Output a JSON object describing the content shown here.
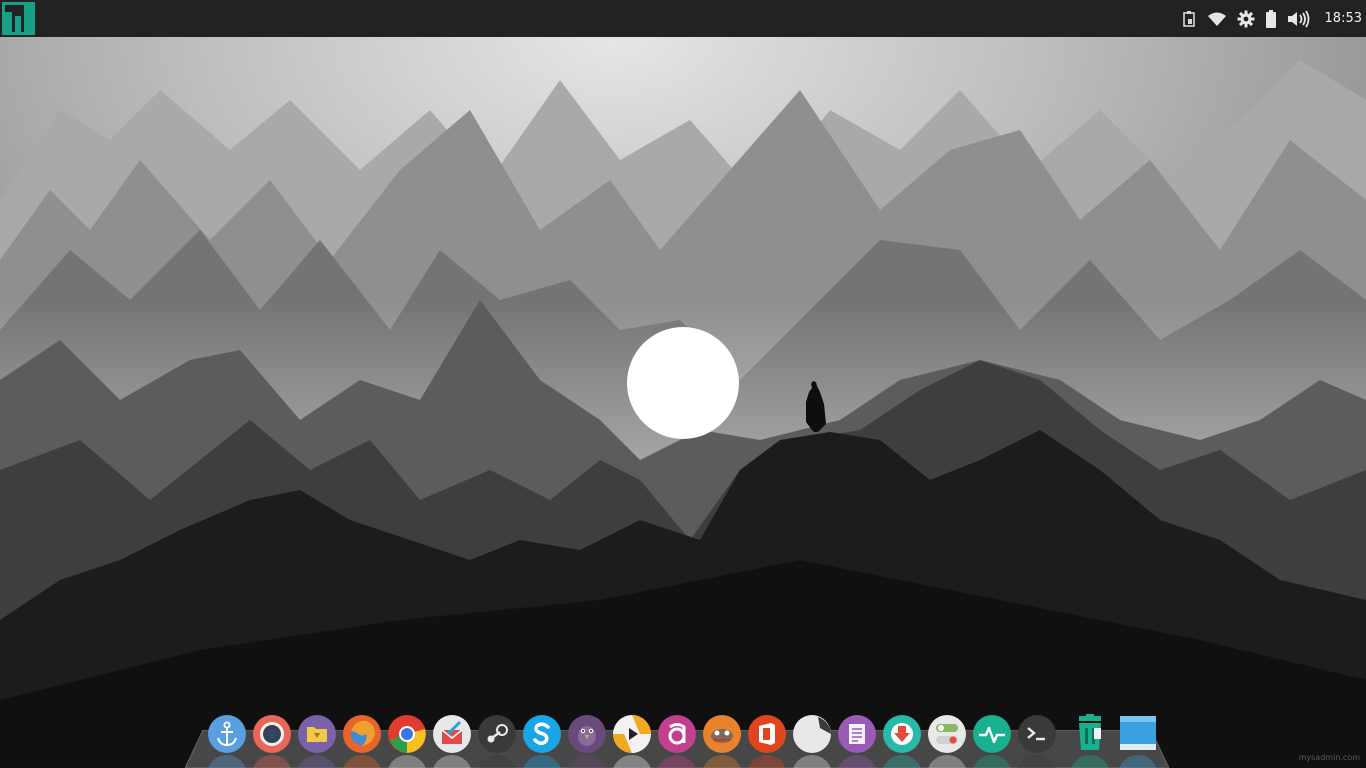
{
  "panel": {
    "clock": "18:53",
    "tray_icons": [
      "clipboard-icon",
      "wifi-icon",
      "settings-gear-icon",
      "battery-icon",
      "volume-icon"
    ],
    "menu_icon": "manjaro-logo-icon",
    "colors": {
      "background": "#222222",
      "accent": "#16a085"
    }
  },
  "dock": {
    "items": [
      {
        "name": "anchor-app-icon",
        "color": "#5aa0e0"
      },
      {
        "name": "screenshot-app-icon",
        "color": "#e8665a"
      },
      {
        "name": "file-manager-icon",
        "color": "#7a62a8"
      },
      {
        "name": "firefox-icon",
        "color": "#e8642c"
      },
      {
        "name": "chrome-icon",
        "color": "#e8e8e8"
      },
      {
        "name": "mail-app-icon",
        "color": "#e8e8e8"
      },
      {
        "name": "steam-icon",
        "color": "#3a3a3a"
      },
      {
        "name": "skype-icon",
        "color": "#1aa6e6"
      },
      {
        "name": "pidgin-icon",
        "color": "#6a4a7a"
      },
      {
        "name": "media-player-icon",
        "color": "#f2f2f2"
      },
      {
        "name": "app-store-icon",
        "color": "#c24090"
      },
      {
        "name": "gimp-icon",
        "color": "#e8822c"
      },
      {
        "name": "office-icon",
        "color": "#e0451e"
      },
      {
        "name": "notes-app-icon",
        "color": "#e8e8e8"
      },
      {
        "name": "text-editor-icon",
        "color": "#9a5ab8"
      },
      {
        "name": "software-update-icon",
        "color": "#2ab8a8"
      },
      {
        "name": "settings-toggle-icon",
        "color": "#e8e8e8"
      },
      {
        "name": "system-monitor-icon",
        "color": "#18b090"
      },
      {
        "name": "terminal-icon",
        "color": "#3a3a3a"
      },
      {
        "name": "trash-icon",
        "color": "#1aaf8f"
      },
      {
        "name": "show-desktop-icon",
        "color": "#3aa0e0"
      }
    ]
  },
  "watermark": "mysadmin.com"
}
